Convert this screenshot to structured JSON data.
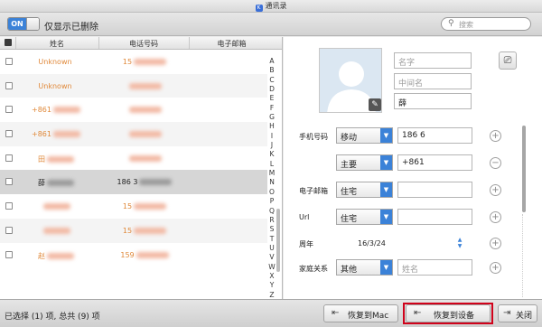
{
  "window": {
    "title": "通讯录"
  },
  "toolbar": {
    "toggle_label": "ON",
    "filter_label": "仅显示已删除",
    "search_placeholder": "搜索"
  },
  "list": {
    "columns": [
      "姓名",
      "电话号码",
      "电子邮箱"
    ],
    "rows": [
      {
        "name": "Unknown",
        "phone": "15",
        "selected": false
      },
      {
        "name": "Unknown",
        "phone": "",
        "selected": false
      },
      {
        "name": "+861",
        "phone": "",
        "selected": false
      },
      {
        "name": "+861",
        "phone": "",
        "selected": false
      },
      {
        "name": "田",
        "phone": "",
        "selected": false
      },
      {
        "name": "薛",
        "phone": "186 3",
        "selected": true
      },
      {
        "name": "",
        "phone": "15",
        "selected": false
      },
      {
        "name": "",
        "phone": "15",
        "selected": false
      },
      {
        "name": "赵",
        "phone": "159",
        "selected": false
      }
    ],
    "alphabet": [
      "A",
      "B",
      "C",
      "D",
      "E",
      "F",
      "G",
      "H",
      "I",
      "J",
      "K",
      "L",
      "M",
      "N",
      "O",
      "P",
      "Q",
      "R",
      "S",
      "T",
      "U",
      "V",
      "W",
      "X",
      "Y",
      "Z"
    ]
  },
  "detail": {
    "first_name_placeholder": "名字",
    "middle_name_placeholder": "中间名",
    "last_name": "薛",
    "phone_label": "手机号码",
    "phone_type_1": "移动",
    "phone_value_1": "186 6",
    "phone_type_2": "主要",
    "phone_value_2": "+861",
    "email_label": "电子邮箱",
    "email_type": "住宅",
    "url_label": "Url",
    "url_type": "住宅",
    "anniversary_label": "周年",
    "anniversary_value": "16/3/24",
    "relation_label": "家庭关系",
    "relation_type": "其他",
    "relation_placeholder": "姓名"
  },
  "statusbar": {
    "status_text": "已选择 (1) 项, 总共 (9) 项",
    "restore_mac_label": "恢复到Mac",
    "restore_device_label": "恢复到设备",
    "close_label": "关闭"
  },
  "colors": {
    "accent": "#3b82d8",
    "deleted_text": "#e0893a",
    "highlight": "#d0021b"
  }
}
